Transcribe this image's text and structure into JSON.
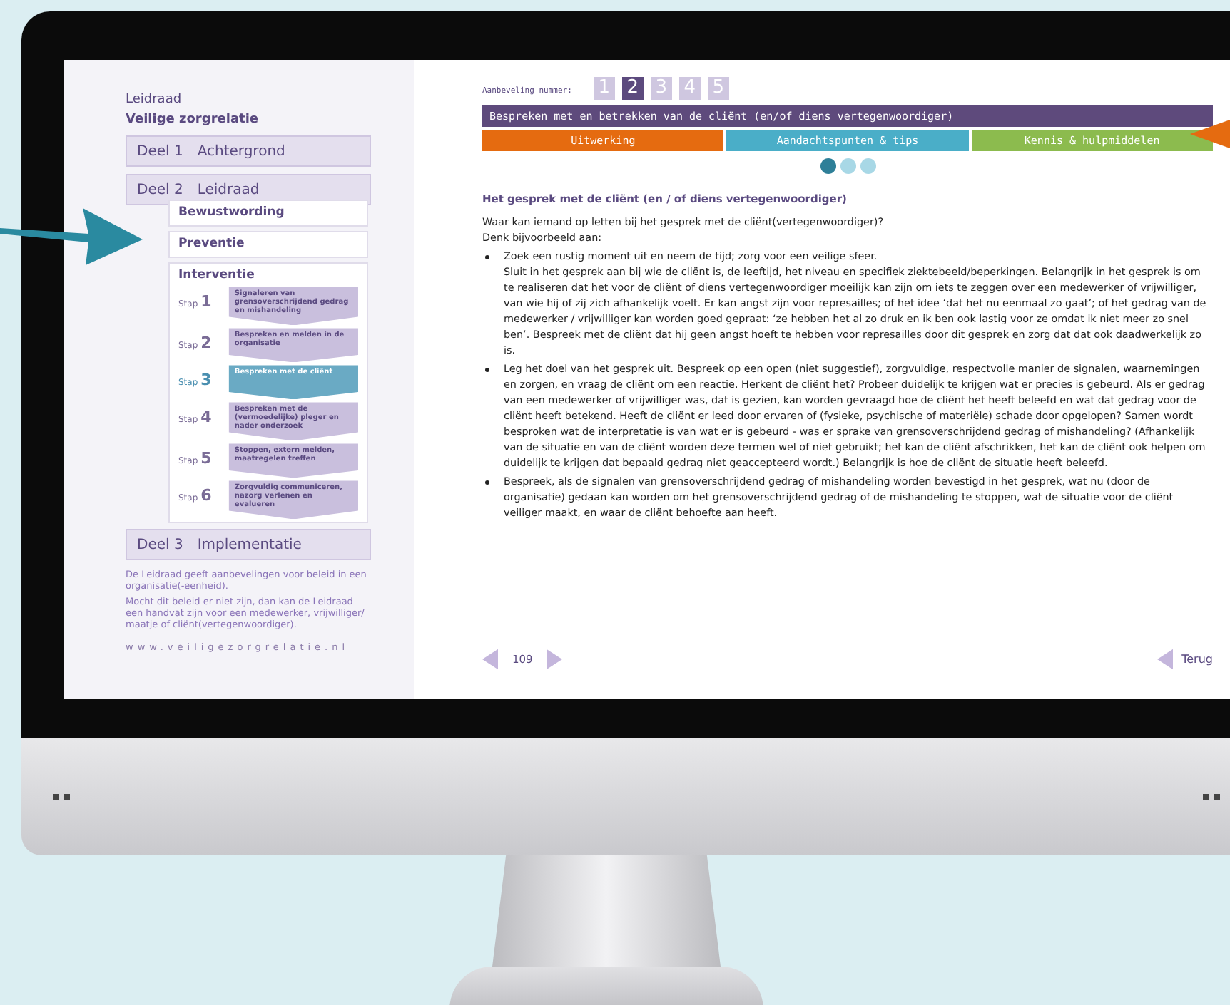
{
  "sidebar": {
    "title": "Leidraad",
    "subtitle": "Veilige zorgrelatie",
    "deel_1": {
      "number": "Deel 1",
      "name": "Achtergrond"
    },
    "deel_2": {
      "number": "Deel 2",
      "name": "Leidraad",
      "sections": [
        {
          "name": "Bewustwording"
        },
        {
          "name": "Preventie"
        },
        {
          "name": "Interventie",
          "steps": [
            {
              "label": "Stap",
              "number": "1",
              "text": "Signaleren van grensoverschrijdend gedrag en mishandeling",
              "selected": false
            },
            {
              "label": "Stap",
              "number": "2",
              "text": "Bespreken en melden in de organisatie",
              "selected": false
            },
            {
              "label": "Stap",
              "number": "3",
              "text": "Bespreken met de cliënt",
              "selected": true
            },
            {
              "label": "Stap",
              "number": "4",
              "text": "Bespreken met de (vermoedelijke) pleger en nader onderzoek",
              "selected": false
            },
            {
              "label": "Stap",
              "number": "5",
              "text": "Stoppen, extern melden, maatregelen treffen",
              "selected": false
            },
            {
              "label": "Stap",
              "number": "6",
              "text": "Zorgvuldig communiceren, nazorg verlenen en evalueren",
              "selected": false
            }
          ]
        }
      ]
    },
    "deel_3": {
      "number": "Deel 3",
      "name": "Implementatie"
    },
    "notes": [
      "De Leidraad geeft aanbevelingen voor beleid in een organisatie(-eenheid).",
      "Mocht dit beleid er niet zijn, dan kan de Leidraad een handvat zijn voor een medewerker, vrijwilliger/ maatje of cliënt(vertegenwoordiger)."
    ],
    "url": "www.veiligezorgrelatie.nl"
  },
  "recommendation": {
    "label": "Aanbeveling nummer:",
    "numbers": [
      {
        "label": "1",
        "selected": false
      },
      {
        "label": "2",
        "selected": true
      },
      {
        "label": "3",
        "selected": false
      },
      {
        "label": "4",
        "selected": false
      },
      {
        "label": "5",
        "selected": false
      }
    ],
    "title": "Bespreken met en betrekken van de cliënt (en/of diens vertegenwoordiger)"
  },
  "tabs": [
    {
      "label": "Uitwerking",
      "color": "#e56b10"
    },
    {
      "label": "Aandachtspunten & tips",
      "color": "#4aaec8"
    },
    {
      "label": "Kennis & hulpmiddelen",
      "color": "#8cbb4e"
    }
  ],
  "page_dots": [
    {
      "selected": true
    },
    {
      "selected": false
    },
    {
      "selected": false
    }
  ],
  "content": {
    "heading": "Het gesprek met de cliënt (en / of diens vertegenwoordiger)",
    "intro": [
      "Waar kan iemand op letten bij het gesprek met de cliënt(vertegenwoordiger)?",
      "Denk bijvoorbeeld aan:"
    ],
    "bullets": [
      {
        "paragraphs": [
          "Zoek een rustig moment uit en neem de tijd; zorg voor een veilige sfeer.",
          "Sluit in het gesprek aan bij wie de cliënt is, de leeftijd, het niveau en specifiek ziektebeeld/beperkingen. Belangrijk in het gesprek is om te realiseren dat het voor de cliënt of diens vertegenwoordiger moeilijk kan zijn om iets te zeggen over een medewerker of vrijwilliger, van wie hij of zij zich afhankelijk voelt. Er kan angst zijn voor represailles; of het idee ‘dat het nu eenmaal zo gaat’; of het gedrag van de medewerker / vrijwilliger kan worden goed gepraat: ‘ze hebben het al zo druk en ik ben ook lastig voor ze omdat ik niet meer zo snel ben’. Bespreek met de cliënt dat hij geen angst hoeft te hebben voor represailles door dit gesprek en zorg dat dat ook daadwerkelijk zo is."
        ]
      },
      {
        "paragraphs": [
          "Leg het doel van het gesprek uit. Bespreek op een open (niet suggestief), zorgvuldige, respectvolle manier de signalen, waarnemingen en zorgen, en vraag de cliënt om een reactie. Herkent de cliënt het? Probeer duidelijk te krijgen wat er precies is gebeurd. Als er gedrag van een medewerker of vrijwilliger was, dat is gezien, kan worden gevraagd hoe de cliënt het heeft beleefd en wat dat gedrag voor de cliënt heeft betekend. Heeft de cliënt er leed door ervaren of (fysieke, psychische of materiële) schade door opgelopen? Samen wordt besproken wat de interpretatie is van wat er is gebeurd - was er sprake van grensoverschrijdend gedrag of mishandeling? (Afhankelijk van de situatie en van de cliënt worden deze termen wel of niet gebruikt; het kan de cliënt afschrikken, het kan de cliënt ook helpen om duidelijk te krijgen dat bepaald gedrag niet geaccepteerd wordt.) Belangrijk is hoe de cliënt de situatie heeft beleefd."
        ]
      },
      {
        "paragraphs": [
          "Bespreek, als de signalen van grensoverschrijdend gedrag of mishandeling worden bevestigd in het gesprek, wat nu (door de organisatie) gedaan kan worden om het grensoverschrijdend gedrag of de mishandeling te stoppen, wat de situatie voor de cliënt veiliger maakt, en waar de cliënt behoefte aan heeft."
        ]
      }
    ]
  },
  "footer": {
    "page": "109",
    "back": "Terug"
  }
}
